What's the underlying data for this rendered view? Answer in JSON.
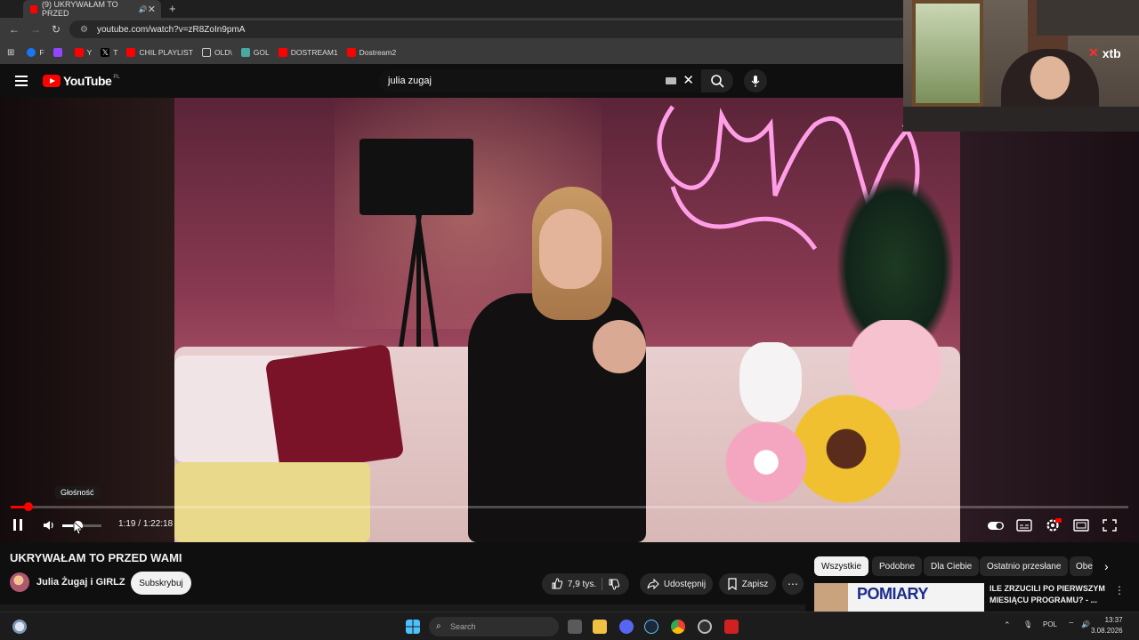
{
  "browser": {
    "tab_title": "(9) UKRYWAŁAM TO PRZED",
    "tab_close": "✕",
    "new_tab": "+",
    "url": "youtube.com/watch?v=zR8ZoIn9pmA",
    "bookmarks": [
      {
        "label": "F",
        "color": "#1877f2"
      },
      {
        "label": "",
        "color": "#9146ff"
      },
      {
        "label": "Y",
        "color": "#ff0000"
      },
      {
        "label": "T",
        "color": "#000000"
      },
      {
        "label": "CHIL PLAYLIST",
        "color": "#ff0000"
      },
      {
        "label": "OLD\\",
        "color": "#888888"
      },
      {
        "label": "GOL",
        "color": "#4aa8a0"
      },
      {
        "label": "DOSTREAM1",
        "color": "#ff0000"
      },
      {
        "label": "Dostream2",
        "color": "#ff0000"
      }
    ]
  },
  "youtube": {
    "logo_text": "YouTube",
    "region": "PL",
    "search_query": "julia zugaj"
  },
  "player": {
    "tooltip": "Głośność",
    "progress": 0.016,
    "volume": 0.38,
    "current_time": "1:19",
    "duration": "1:22:18",
    "time_separator": " / "
  },
  "webcam": {
    "brand": "xtb",
    "brand_mark": "✕"
  },
  "video": {
    "title": "UKRYWAŁAM TO PRZED WAMI",
    "channel": "Julia Żugaj i GIRLZ",
    "subscribe": "Subskrybuj",
    "likes": "7,9 tys.",
    "share": "Udostępnij",
    "save": "Zapisz"
  },
  "recommendations": {
    "chips": [
      "Wszystkie",
      "Podobne",
      "Dla Ciebie",
      "Ostatnio przesłane",
      "Obe"
    ],
    "active_chip": 0,
    "item": {
      "thumb_text": "POMIARY",
      "title": "ILE ZRZUCILI PO PIERWSZYM MIESIĄCU PROGRAMU? - ..."
    }
  },
  "taskbar": {
    "search_placeholder": "Search",
    "language": "POL",
    "time": "13:37",
    "date": "3.08.2026"
  },
  "colors": {
    "youtube_red": "#ff0000",
    "background": "#0f0f0f",
    "chip_bg": "#272727"
  }
}
